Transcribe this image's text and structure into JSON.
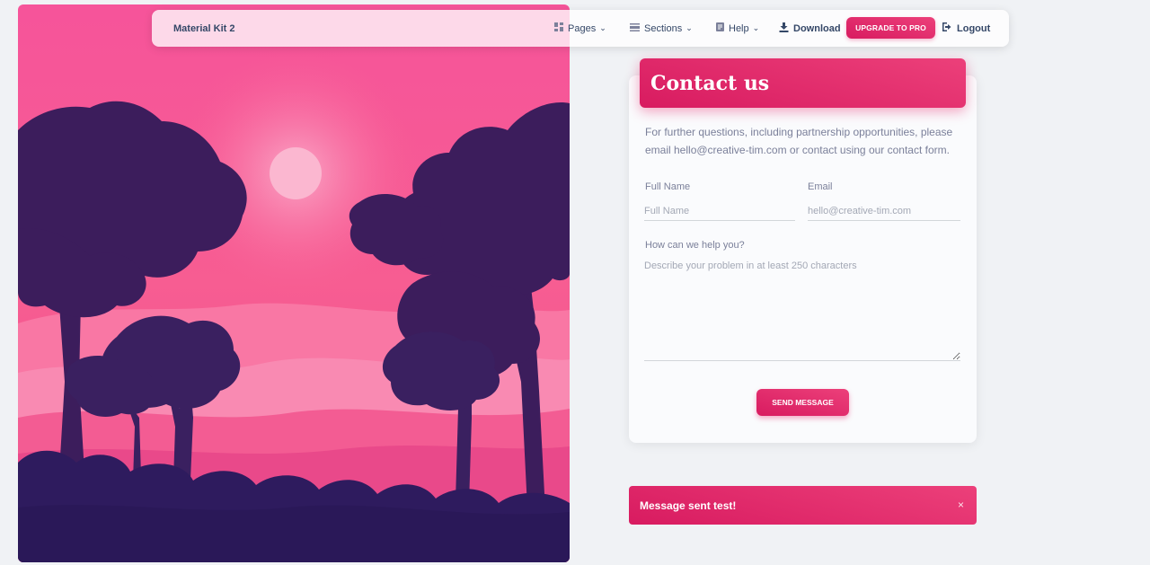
{
  "navbar": {
    "brand": "Material Kit 2",
    "items": [
      {
        "label": "Pages",
        "icon": "dashboard-icon",
        "dropdown": true
      },
      {
        "label": "Sections",
        "icon": "view-day-icon",
        "dropdown": true
      },
      {
        "label": "Help",
        "icon": "article-icon",
        "dropdown": true
      }
    ],
    "download_label": "Download",
    "upgrade_label": "UPGRADE TO PRO",
    "logout_label": "Logout"
  },
  "contact": {
    "title": "Contact us",
    "intro": "For further questions, including partnership opportunities, please email hello@creative-tim.com or contact using our contact form.",
    "full_name": {
      "label": "Full Name",
      "placeholder": "Full Name"
    },
    "email": {
      "label": "Email",
      "placeholder": "hello@creative-tim.com"
    },
    "message": {
      "label": "How can we help you?",
      "placeholder": "Describe your problem in at least 250 characters"
    },
    "send_label": "SEND MESSAGE"
  },
  "alert": {
    "text": "Message sent test!",
    "close_label": "×"
  },
  "colors": {
    "primary": "#e91e63",
    "text_dark": "#344767",
    "text_muted": "#7b809a",
    "background": "#f0f2f5"
  }
}
